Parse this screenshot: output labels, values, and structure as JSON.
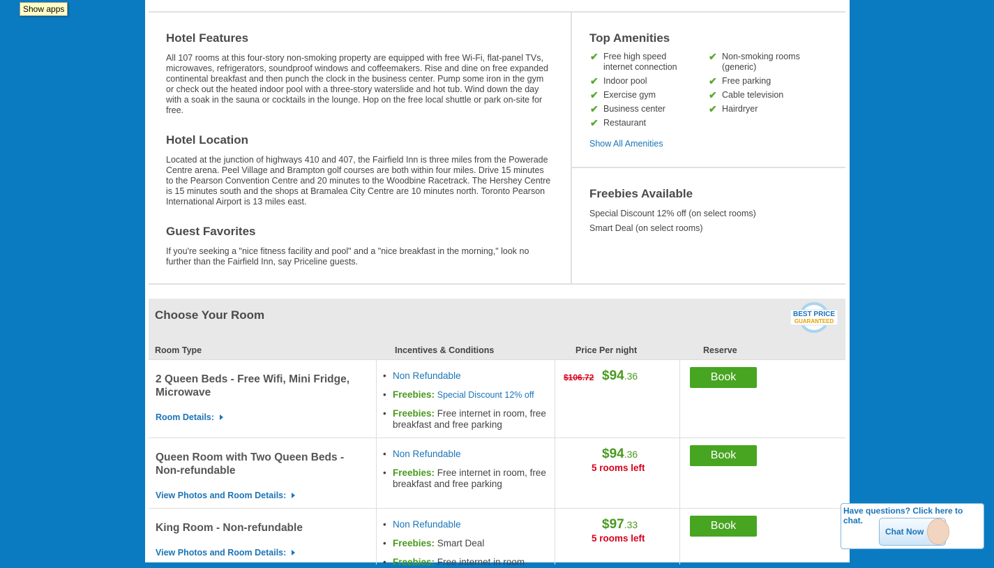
{
  "tooltip": "Show apps",
  "features": {
    "title": "Hotel Features",
    "text": "All 107 rooms at this four-story non-smoking property are equipped with free Wi-Fi, flat-panel TVs, microwaves, refrigerators, soundproof windows and coffeemakers. Rise and dine on free expanded continental breakfast and then punch the clock in the business center. Pump some iron in the gym or check out the heated indoor pool with a three-story waterslide and hot tub. Wind down the day with a soak in the sauna or cocktails in the lounge. Hop on the free local shuttle or park on-site for free."
  },
  "location": {
    "title": "Hotel Location",
    "text": "Located at the junction of highways 410 and 407, the Fairfield Inn is three miles from the Powerade Centre arena. Peel Village and Brampton golf courses are both within four miles. Drive 15 minutes to the Pearson Convention Centre and 20 minutes to the Woodbine Racetrack. The Hershey Centre is 15 minutes south and the shops at Bramalea City Centre are 10 minutes north. Toronto Pearson International Airport is 13 miles east."
  },
  "favorites": {
    "title": "Guest Favorites",
    "text": "If you're seeking a \"nice fitness facility and pool\" and a \"nice breakfast in the morning,\" look no further than the Fairfield Inn, say Priceline guests."
  },
  "amenities": {
    "title": "Top Amenities",
    "left": [
      "Free high speed internet connection",
      "Indoor pool",
      "Exercise gym",
      "Business center",
      "Restaurant"
    ],
    "right": [
      "Non-smoking rooms (generic)",
      "Free parking",
      "Cable television",
      "Hairdryer"
    ],
    "show_all": "Show All Amenities"
  },
  "freebies": {
    "title": "Freebies Available",
    "items": [
      "Special Discount 12% off (on select rooms)",
      "Smart Deal (on select rooms)"
    ]
  },
  "rooms": {
    "title": "Choose Your Room",
    "badge_line1": "BEST PRICE",
    "badge_line2": "GUARANTEED",
    "headers": [
      "Room Type",
      "Incentives & Conditions",
      "Price Per night",
      "Reserve"
    ],
    "list": [
      {
        "name": "2 Queen Beds - Free Wifi, Mini Fridge, Microwave",
        "details": "Room Details:",
        "inc1": "Non Refundable",
        "freebies_label": "Freebies:",
        "inc2": "Special Discount 12% off",
        "inc3": "Free internet in room, free breakfast and free parking",
        "old_price": "$106.72",
        "price_main": "$94",
        "price_cents": ".36",
        "book": "Book"
      },
      {
        "name": "Queen Room with Two Queen Beds - Non-refundable",
        "details": "View Photos and Room Details:",
        "inc1": "Non Refundable",
        "freebies_label": "Freebies:",
        "inc2": "Free internet in room, free breakfast and free parking",
        "price_main": "$94",
        "price_cents": ".36",
        "rooms_left": "5 rooms left",
        "book": "Book"
      },
      {
        "name": "King Room - Non-refundable",
        "details": "View Photos and Room Details:",
        "inc1": "Non Refundable",
        "freebies_label": "Freebies:",
        "inc2": "Smart Deal",
        "inc3": "Free internet in room",
        "price_main": "$97",
        "price_cents": ".33",
        "rooms_left": "5 rooms left",
        "book": "Book"
      }
    ]
  },
  "chat": {
    "question": "Have questions?  Click here to chat.",
    "button": "Chat Now"
  }
}
